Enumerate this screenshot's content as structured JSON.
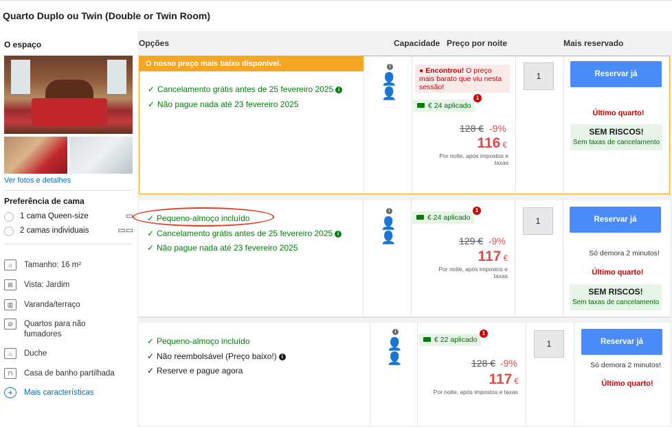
{
  "room": {
    "title": "Quarto Duplo ou Twin (Double or Twin Room)"
  },
  "columns": {
    "space": "O espaço",
    "options": "Opções",
    "capacity": "Capacidade",
    "price": "Preço por noite",
    "popular": "Mais reservado"
  },
  "sidebar": {
    "photos_link": "Ver fotos e detalhes",
    "bed_pref_title": "Preferência de cama",
    "bed_options": [
      {
        "label": "1 cama Queen-size",
        "icon": "double-bed-icon"
      },
      {
        "label": "2 camas individuais",
        "icon": "twin-beds-icon"
      }
    ],
    "features": [
      {
        "label": "Tamanho: 16 m²",
        "icon": "size-icon"
      },
      {
        "label": "Vista: Jardim",
        "icon": "garden-view-icon"
      },
      {
        "label": "Varanda/terraço",
        "icon": "balcony-icon"
      },
      {
        "label": "Quartos para não fumadores",
        "icon": "no-smoking-icon"
      },
      {
        "label": "Duche",
        "icon": "shower-icon"
      },
      {
        "label": "Casa de banho partilhada",
        "icon": "shared-bathroom-icon"
      }
    ],
    "more_link": "Mais características"
  },
  "options": [
    {
      "banner": "O nosso preço mais baixo disponível.",
      "conditions": [
        "Cancelamento grátis antes de 25 fevereiro 2025",
        "Não pague nada até 23 fevereiro 2025"
      ],
      "found_bold": "Encontrou!",
      "found_text": " O preço mais barato que viu nesta sessão!",
      "discount": "€ 24 aplicado",
      "badge": "1",
      "old_price": "128 €",
      "percent": "-9%",
      "price": "116",
      "currency": "€",
      "note": "Por noite, após impostos e taxas",
      "qty": "1",
      "button": "Reservar já",
      "last_room": "Último quarto!",
      "no_risk_title": "SEM RISCOS!",
      "no_risk_sub": "Sem taxas de cancelamento"
    },
    {
      "conditions": [
        "Pequeno-almoço incluído",
        "Cancelamento grátis antes de 25 fevereiro 2025",
        "Não pague nada até 23 fevereiro 2025"
      ],
      "discount": "€ 24 aplicado",
      "badge": "1",
      "old_price": "129 €",
      "percent": "-9%",
      "price": "117",
      "currency": "€",
      "note": "Por noite, após impostos e taxas",
      "qty": "1",
      "button": "Reservar já",
      "wait": "Só demora 2 minutos!",
      "last_room": "Último quarto!",
      "no_risk_title": "SEM RISCOS!",
      "no_risk_sub": "Sem taxas de cancelamento"
    },
    {
      "conditions": [
        "Pequeno-almoço incluído",
        "Não reembolsável (Preço baixo!)",
        "Reserve e pague agora"
      ],
      "discount": "€ 22 aplicado",
      "badge": "1",
      "old_price": "128 €",
      "percent": "-9%",
      "price": "117",
      "currency": "€",
      "note": "Por noite, após impostos e taxas",
      "qty": "1",
      "button": "Reservar já",
      "wait": "Só demora 2 minutos!",
      "last_room": "Último quarto!"
    }
  ],
  "check_mark": "✓",
  "info_glyph": "i",
  "colors": {
    "accent": "#f5a623",
    "green": "#008009",
    "red": "#cc0000",
    "button": "#4a8cf7",
    "highlight_ring": "#e53b1e"
  }
}
